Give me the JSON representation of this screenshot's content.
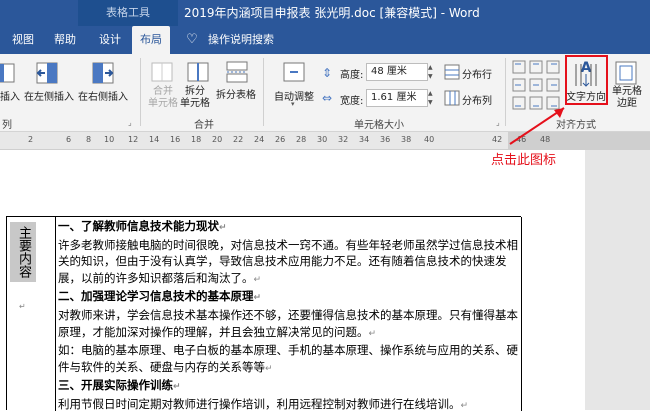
{
  "window": {
    "contextual_tab": "表格工具",
    "title": "2019年内涵项目申报表 张光明.doc [兼容模式] - Word"
  },
  "tabs": [
    "视图",
    "帮助",
    "设计",
    "布局",
    "操作说明搜索"
  ],
  "active_tab": "布局",
  "ribbon": {
    "rows_cols": {
      "insert_left_cut": "插入",
      "insert_left": "在左侧插入",
      "insert_right": "在右侧插入",
      "label_cut": "列"
    },
    "merge": {
      "merge_cells": [
        "合并",
        "单元格"
      ],
      "split_cells": [
        "拆分",
        "单元格"
      ],
      "split_table": "拆分表格",
      "label": "合并"
    },
    "cell_size": {
      "autofit": "自动调整",
      "height_label": "高度:",
      "height_value": "48 厘米",
      "width_label": "宽度:",
      "width_value": "1.61 厘米",
      "distribute_rows": "分布行",
      "distribute_cols": "分布列",
      "label": "单元格大小"
    },
    "alignment": {
      "text_direction": "文字方向",
      "cell_margins": [
        "单元格",
        "边距"
      ],
      "label": "对齐方式"
    }
  },
  "ruler": {
    "numbers": [
      "2",
      "6",
      "8",
      "10",
      "12",
      "14",
      "16",
      "18",
      "20",
      "22",
      "24",
      "26",
      "28",
      "30",
      "32",
      "34",
      "36",
      "38",
      "40",
      "42",
      "46",
      "48"
    ]
  },
  "annotation": {
    "text": "点击此图标",
    "color": "#e5101b"
  },
  "table": {
    "left_cell": "主要内容",
    "paragraphs": [
      {
        "text": "一、了解教师信息技术能力现状",
        "bold": true
      },
      {
        "text": "许多老教师接触电脑的时间很晚，对信息技术一窍不通。有些年轻老师虽然学过信息技术相关的知识，但由于没有认真学，导致信息技术应用能力不足。还有随着信息技术的快速发展，以前的许多知识都落后和淘汰了。",
        "bold": false
      },
      {
        "text": "二、加强理论学习信息技术的基本原理",
        "bold": true
      },
      {
        "text": "对教师来讲，学会信息技术基本操作还不够，还要懂得信息技术的基本原理。只有懂得基本原理，才能加深对操作的理解，并且会独立解决常见的问题。",
        "bold": false
      },
      {
        "text": "如：电脑的基本原理、电子白板的基本原理、手机的基本原理、操作系统与应用的关系、硬件与软件的关系、硬盘与内存的关系等等",
        "bold": false
      },
      {
        "text": "三、开展实际操作训练",
        "bold": true
      },
      {
        "text": "利用节假日时间定期对教师进行操作培训，利用远程控制对教师进行在线培训。",
        "bold": false
      }
    ]
  },
  "colors": {
    "title_bar": "#2b579a",
    "ribbon_bg": "#f3f3f3",
    "callout": "#e5101b"
  }
}
